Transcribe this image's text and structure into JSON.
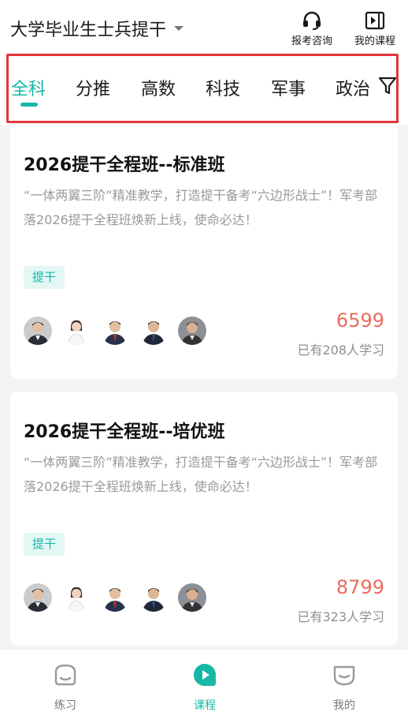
{
  "header": {
    "exam_type": "大学毕业生士兵提干",
    "consult_label": "报考咨询",
    "my_courses_label": "我的课程"
  },
  "tabs": [
    {
      "label": "全科",
      "active": true
    },
    {
      "label": "分推",
      "active": false
    },
    {
      "label": "高数",
      "active": false
    },
    {
      "label": "科技",
      "active": false
    },
    {
      "label": "军事",
      "active": false
    },
    {
      "label": "政治",
      "active": false
    }
  ],
  "courses": [
    {
      "title": "2026提干全程班--标准班",
      "description": "“一体两翼三阶”精准教学，打造提干备考“六边形战士”！军考部落2026提干全程班焕新上线，使命必达！",
      "tag": "提干",
      "price": "6599",
      "learners": "已有208人学习",
      "teacher_count": 5
    },
    {
      "title": "2026提干全程班--培优班",
      "description": "“一体两翼三阶”精准教学，打造提干备考“六边形战士”！军考部落2026提干全程班焕新上线，使命必达！",
      "tag": "提干",
      "price": "8799",
      "learners": "已有323人学习",
      "teacher_count": 5
    }
  ],
  "bottom_nav": [
    {
      "label": "练习",
      "icon": "practice-icon",
      "active": false
    },
    {
      "label": "课程",
      "icon": "course-play-icon",
      "active": true
    },
    {
      "label": "我的",
      "icon": "profile-icon",
      "active": false
    }
  ],
  "colors": {
    "accent": "#16b7a5",
    "price": "#ec6a5c",
    "highlight_border": "#e0363a"
  }
}
